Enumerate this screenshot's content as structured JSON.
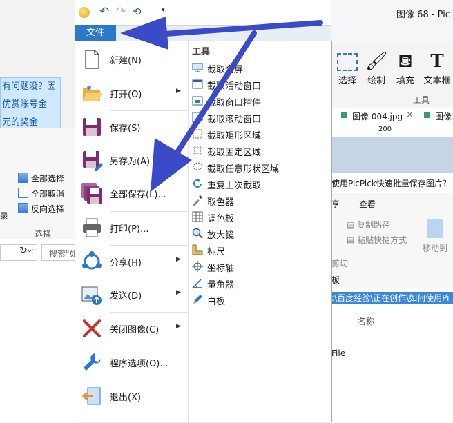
{
  "background": {
    "blue_panel": [
      "有问题没？因",
      "优赏账号金",
      "元的奖金"
    ],
    "explorer_selection": {
      "select_all": "全部选择",
      "select_none": "全部取消",
      "invert": "反向选择",
      "group": "选择",
      "left_stub": "录",
      "search_placeholder": "搜索\"如",
      "nav": "﹀"
    },
    "right_window": {
      "title": "图像 68 - Pic",
      "ribbon": {
        "select": "选择",
        "draw": "绘制",
        "fill": "填充",
        "textbox": "文本框",
        "group": "工具"
      },
      "tab": "图像 004.jpg",
      "tab_other": "图像",
      "ruler_mark": "200"
    },
    "explorer2": {
      "title": "使用PicPick快速批量保存图片？",
      "share": "享",
      "view": "查看",
      "copy_path": "复制路径",
      "paste_shortcut": "粘贴快捷方式",
      "move_to": "移动到",
      "cut": "剪切",
      "board": "板",
      "address": ":\\百度经验\\正在创作\\如何使用Pi",
      "name_col": "名称",
      "file_label": "File"
    }
  },
  "app": {
    "file_tab": "文件",
    "menu": [
      {
        "label": "新建(N)",
        "icon": "new-file-icon",
        "arrow": false
      },
      {
        "label": "打开(O)",
        "icon": "open-folder-icon",
        "arrow": true
      },
      {
        "label": "保存(S)",
        "icon": "save-icon",
        "arrow": false
      },
      {
        "label": "另存为(A)",
        "icon": "save-as-icon",
        "arrow": false
      },
      {
        "label": "全部保存(L)...",
        "icon": "save-all-icon",
        "arrow": false
      },
      {
        "label": "打印(P)...",
        "icon": "printer-icon",
        "arrow": false
      },
      {
        "label": "分享(H)",
        "icon": "share-icon",
        "arrow": true
      },
      {
        "label": "发送(D)",
        "icon": "send-icon",
        "arrow": true
      },
      {
        "label": "关闭图像(C)",
        "icon": "close-image-icon",
        "arrow": true
      },
      {
        "label": "程序选项(O)...",
        "icon": "wrench-icon",
        "arrow": false
      },
      {
        "label": "退出(X)",
        "icon": "exit-icon",
        "arrow": false
      }
    ],
    "tools_title": "工具",
    "tools": [
      {
        "label": "截取全屏",
        "icon": "monitor-icon"
      },
      {
        "label": "截取活动窗口",
        "icon": "window-icon"
      },
      {
        "label": "截取窗口控件",
        "icon": "control-icon"
      },
      {
        "label": "截取滚动窗口",
        "icon": "scroll-window-icon"
      },
      {
        "label": "截取矩形区域",
        "icon": "rectangle-region-icon"
      },
      {
        "label": "截取固定区域",
        "icon": "fixed-region-icon"
      },
      {
        "label": "截取任意形状区域",
        "icon": "freehand-region-icon"
      },
      {
        "label": "重复上次截取",
        "icon": "repeat-icon"
      },
      {
        "label": "取色器",
        "icon": "eyedropper-icon"
      },
      {
        "label": "调色板",
        "icon": "palette-icon"
      },
      {
        "label": "放大镜",
        "icon": "magnifier-icon"
      },
      {
        "label": "标尺",
        "icon": "ruler-icon"
      },
      {
        "label": "坐标轴",
        "icon": "crosshair-icon"
      },
      {
        "label": "量角器",
        "icon": "protractor-icon"
      },
      {
        "label": "白板",
        "icon": "whiteboard-icon"
      }
    ]
  },
  "colors": {
    "accent": "#2b79c8",
    "arrow": "#3b4bc8"
  }
}
